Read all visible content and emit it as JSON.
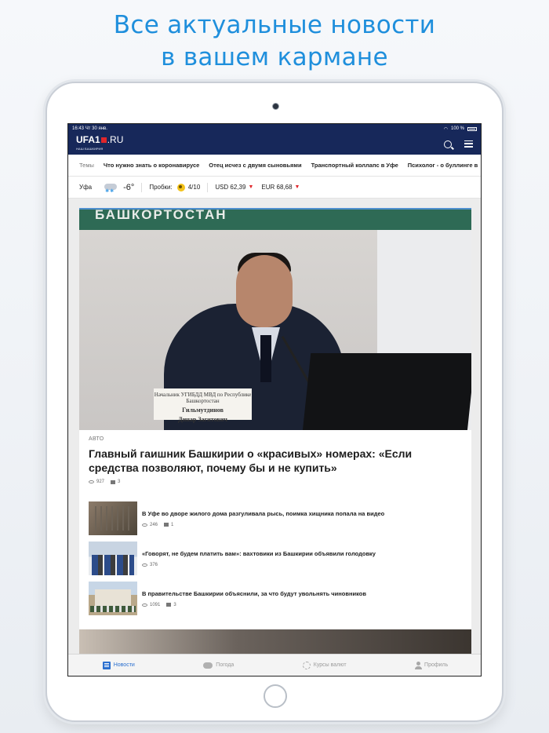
{
  "promo": {
    "line1": "Все актуальные новости",
    "line2": "в вашем кармане"
  },
  "statusbar": {
    "time": "16:43",
    "date": "Чт 30 янв.",
    "battery": "100 %"
  },
  "app": {
    "logo_main": "UFA1",
    "logo_suffix": ".RU",
    "logo_tagline": "НАШ БАШКИРИЯ"
  },
  "topics": {
    "label": "Темы",
    "items": [
      "Что нужно знать о коронавирусе",
      "Отец исчез с двумя сыновьями",
      "Транспортный коллапс в Уфе",
      "Психолог - о буллинге в"
    ]
  },
  "info": {
    "city": "Уфа",
    "weather_icon": "cloud-snow-icon",
    "temperature": "-6°",
    "traffic_label": "Пробки:",
    "traffic_value": "4/10",
    "usd": "USD 62,39",
    "eur": "EUR 68,68",
    "down_arrow": "▼"
  },
  "hero": {
    "banner_text": "БАШКОРТОСТАН",
    "plate_line": "Начальник УГИБДД МВД по Республике Башкортостан",
    "plate_name_1": "Гильмутдинов",
    "plate_name_2": "Динар Загитович",
    "rubric": "АВТО",
    "title": "Главный гаишник Башкирии о «красивых» номерах: «Если средства позволяют, почему бы и не купить»",
    "views": "927",
    "comments": "3"
  },
  "news": [
    {
      "title": "В Уфе во дворе жилого дома разгуливала рысь, поимка хищника попала на видео",
      "views": "246",
      "comments": "1"
    },
    {
      "title": "«Говорят, не будем платить вам»: вахтовики из Башкирии объявили голодовку",
      "views": "376",
      "comments": ""
    },
    {
      "title": "В правительстве Башкирии объяснили, за что будут увольнять чиновников",
      "views": "1091",
      "comments": "3"
    }
  ],
  "tabs": [
    {
      "label": "Новости",
      "icon": "news-icon",
      "active": true
    },
    {
      "label": "Погода",
      "icon": "weather-icon",
      "active": false
    },
    {
      "label": "Курсы валют",
      "icon": "currency-icon",
      "active": false
    },
    {
      "label": "Профиль",
      "icon": "profile-icon",
      "active": false
    }
  ],
  "colors": {
    "accent": "#1f8fdc",
    "header": "#17285a",
    "brand_red": "#e0262b",
    "tab_active": "#2a6fcf"
  }
}
